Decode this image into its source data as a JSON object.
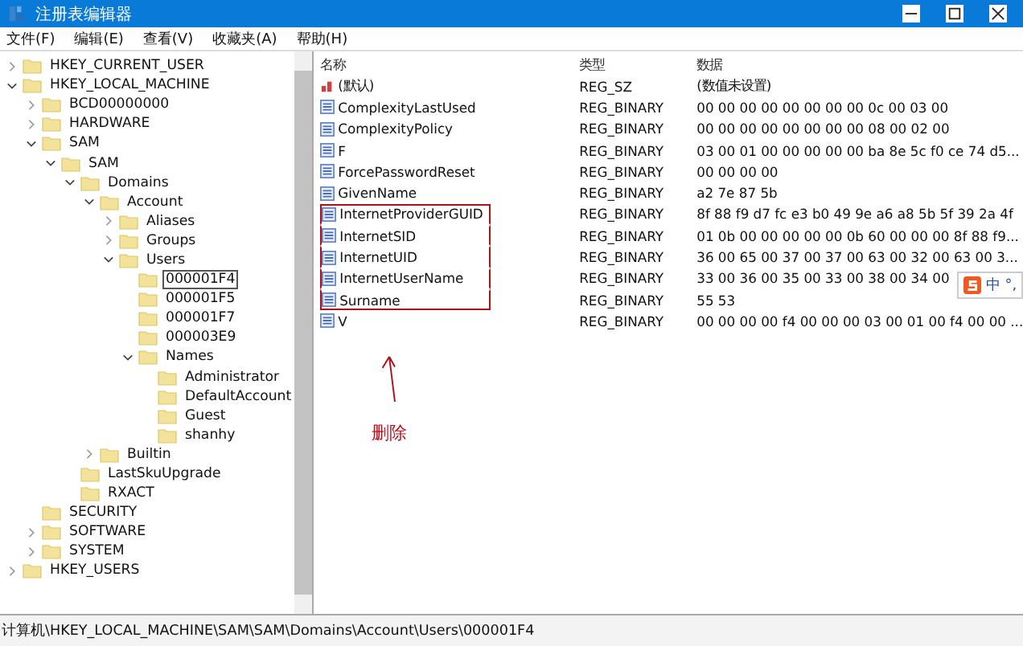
{
  "window": {
    "title": "注册表编辑器"
  },
  "menu": [
    "文件(F)",
    "编辑(E)",
    "查看(V)",
    "收藏夹(A)",
    "帮助(H)"
  ],
  "tree": [
    {
      "label": "HKEY_CURRENT_USER",
      "expanded": false,
      "selected": false
    },
    {
      "label": "HKEY_LOCAL_MACHINE",
      "expanded": true,
      "selected": false,
      "children": [
        {
          "label": "BCD00000000",
          "expanded": false,
          "selected": false
        },
        {
          "label": "HARDWARE",
          "expanded": false,
          "selected": false
        },
        {
          "label": "SAM",
          "expanded": true,
          "selected": false,
          "children": [
            {
              "label": "SAM",
              "expanded": true,
              "selected": false,
              "children": [
                {
                  "label": "Domains",
                  "expanded": true,
                  "selected": false,
                  "children": [
                    {
                      "label": "Account",
                      "expanded": true,
                      "selected": false,
                      "children": [
                        {
                          "label": "Aliases",
                          "expanded": false,
                          "selected": false
                        },
                        {
                          "label": "Groups",
                          "expanded": false,
                          "selected": false
                        },
                        {
                          "label": "Users",
                          "expanded": true,
                          "selected": false,
                          "children": [
                            {
                              "label": "000001F4",
                              "selected": true
                            },
                            {
                              "label": "000001F5",
                              "selected": false
                            },
                            {
                              "label": "000001F7",
                              "selected": false
                            },
                            {
                              "label": "000003E9",
                              "selected": false
                            },
                            {
                              "label": "Names",
                              "expanded": true,
                              "selected": false,
                              "children": [
                                {
                                  "label": "Administrator",
                                  "selected": false
                                },
                                {
                                  "label": "DefaultAccount",
                                  "selected": false
                                },
                                {
                                  "label": "Guest",
                                  "selected": false
                                },
                                {
                                  "label": "shanhy",
                                  "selected": false
                                }
                              ]
                            }
                          ]
                        }
                      ]
                    },
                    {
                      "label": "Builtin",
                      "expanded": false,
                      "selected": false
                    }
                  ]
                },
                {
                  "label": "LastSkuUpgrade",
                  "selected": false
                },
                {
                  "label": "RXACT",
                  "selected": false
                }
              ]
            }
          ]
        },
        {
          "label": "SECURITY",
          "selected": false
        },
        {
          "label": "SOFTWARE",
          "expanded": false,
          "selected": false
        },
        {
          "label": "SYSTEM",
          "expanded": false,
          "selected": false
        }
      ]
    },
    {
      "label": "HKEY_USERS",
      "expanded": false,
      "selected": false
    }
  ],
  "table": {
    "columns": [
      "名称",
      "类型",
      "数据"
    ],
    "rows": [
      {
        "kind": "string",
        "name": "(默认)",
        "type": "REG_SZ",
        "data": "(数值未设置)",
        "boxed": false
      },
      {
        "kind": "binary",
        "name": "ComplexityLastUsed",
        "type": "REG_BINARY",
        "data": "00 00 00 00 00 00 00 00 0c 00 03 00",
        "boxed": false
      },
      {
        "kind": "binary",
        "name": "ComplexityPolicy",
        "type": "REG_BINARY",
        "data": "00 00 00 00 00 00 00 00 08 00 02 00",
        "boxed": false
      },
      {
        "kind": "binary",
        "name": "F",
        "type": "REG_BINARY",
        "data": "03 00 01 00 00 00 00 00 ba 8e 5c f0 ce 74 d5...",
        "boxed": false
      },
      {
        "kind": "binary",
        "name": "ForcePasswordReset",
        "type": "REG_BINARY",
        "data": "00 00 00 00",
        "boxed": false
      },
      {
        "kind": "binary",
        "name": "GivenName",
        "type": "REG_BINARY",
        "data": "a2 7e 87 5b",
        "boxed": false
      },
      {
        "kind": "binary",
        "name": "InternetProviderGUID",
        "type": "REG_BINARY",
        "data": "8f 88 f9 d7 fc e3 b0 49 9e a6 a8 5b 5f 39 2a 4f",
        "boxed": true
      },
      {
        "kind": "binary",
        "name": "InternetSID",
        "type": "REG_BINARY",
        "data": "01 0b 00 00 00 00 00 0b 60 00 00 00 8f 88 f9...",
        "boxed": true
      },
      {
        "kind": "binary",
        "name": "InternetUID",
        "type": "REG_BINARY",
        "data": "36 00 65 00 37 00 37 00 63 00 32 00 63 00 3...",
        "boxed": true
      },
      {
        "kind": "binary",
        "name": "InternetUserName",
        "type": "REG_BINARY",
        "data": "33 00 36 00 35 00 33 00 38 00 34 00",
        "boxed": true
      },
      {
        "kind": "binary",
        "name": "Surname",
        "type": "REG_BINARY",
        "data": "55 53",
        "boxed": true
      },
      {
        "kind": "binary",
        "name": "V",
        "type": "REG_BINARY",
        "data": "00 00 00 00 f4 00 00 00 03 00 01 00 f4 00 00 ...",
        "boxed": false
      }
    ]
  },
  "annotation": {
    "label": "删除"
  },
  "ime_toolbar": {
    "items": [
      "中",
      "°,"
    ]
  },
  "status_bar": "计算机\\HKEY_LOCAL_MACHINE\\SAM\\SAM\\Domains\\Account\\Users\\000001F4"
}
